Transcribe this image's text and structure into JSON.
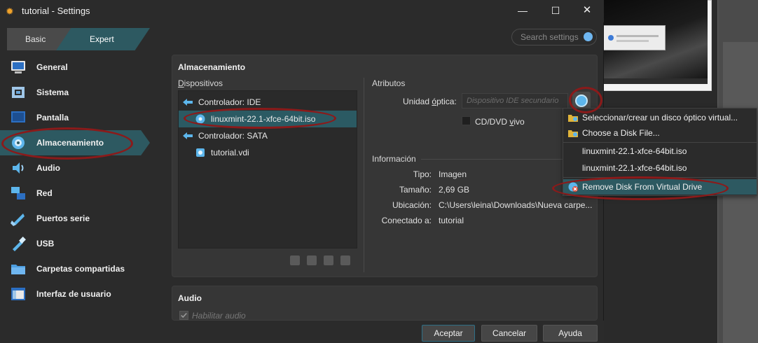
{
  "window": {
    "title": "tutorial - Settings",
    "app_icon": "gear-icon",
    "controls": {
      "minimize": "—",
      "maximize": "☐",
      "close": "✕"
    }
  },
  "mode_tabs": {
    "basic": "Basic",
    "expert": "Expert",
    "selected": "Expert"
  },
  "search": {
    "placeholder": "Search settings"
  },
  "sidebar": {
    "selected": "Almacenamiento",
    "items": [
      {
        "label": "General",
        "icon": "monitor-icon"
      },
      {
        "label": "Sistema",
        "icon": "chip-icon"
      },
      {
        "label": "Pantalla",
        "icon": "display-icon"
      },
      {
        "label": "Almacenamiento",
        "icon": "disk-icon"
      },
      {
        "label": "Audio",
        "icon": "speaker-icon"
      },
      {
        "label": "Red",
        "icon": "network-icon"
      },
      {
        "label": "Puertos serie",
        "icon": "serial-port-icon"
      },
      {
        "label": "USB",
        "icon": "usb-icon"
      },
      {
        "label": "Carpetas compartidas",
        "icon": "folder-icon"
      },
      {
        "label": "Interfaz de usuario",
        "icon": "window-icon"
      }
    ]
  },
  "storage": {
    "title": "Almacenamiento",
    "devices_label": "Dispositivos",
    "devices_label_accel": "D",
    "devices_label_rest": "ispositivos",
    "tree": [
      {
        "label": "Controlador: IDE",
        "icon": "ide-controller-icon"
      },
      {
        "label": "linuxmint-22.1-xfce-64bit.iso",
        "icon": "optical-disc-icon",
        "selected": true
      },
      {
        "label": "Controlador: SATA",
        "icon": "sata-controller-icon"
      },
      {
        "label": "tutorial.vdi",
        "icon": "hard-disk-icon"
      }
    ],
    "attributes_label": "Atributos",
    "optical_drive_label": "Unidad óptica:",
    "optical_drive_label_pre": "Unidad ",
    "optical_drive_label_accel": "ó",
    "optical_drive_label_post": "ptica:",
    "optical_drive_value": "Dispositivo IDE secundario",
    "live_cd_label_pre": "CD/DVD ",
    "live_cd_label_accel": "v",
    "live_cd_label_post": "ivo",
    "live_cd_checked": false,
    "info_label": "Información",
    "info": {
      "type_key": "Tipo:",
      "type_value": "Imagen",
      "size_key": "Tamaño:",
      "size_value": "2,69 GB",
      "location_key": "Ubicación:",
      "location_value": "C:\\Users\\leina\\Downloads\\Nueva carpe...",
      "attached_key": "Conectado a:",
      "attached_value": "tutorial"
    }
  },
  "audio": {
    "title": "Audio",
    "enable_label": "Habilitar audio",
    "enabled": true
  },
  "disk_menu": {
    "items": [
      {
        "label": "Seleccionar/crear un disco óptico virtual...",
        "icon": "folder-disc-icon"
      },
      {
        "label": "Choose a Disk File...",
        "icon": "folder-disc-icon"
      },
      {
        "label": "linuxmint-22.1-xfce-64bit.iso",
        "icon": ""
      },
      {
        "label": "linuxmint-22.1-xfce-64bit.iso",
        "icon": ""
      },
      {
        "label": "Remove Disk From Virtual Drive",
        "icon": "remove-disc-icon",
        "selected": true
      }
    ]
  },
  "buttons": {
    "ok": "Aceptar",
    "cancel": "Cancelar",
    "help": "Ayuda"
  },
  "colors": {
    "selection": "#2d5961",
    "annotation": "#8b1a1a",
    "accent": "#5db6ec"
  }
}
